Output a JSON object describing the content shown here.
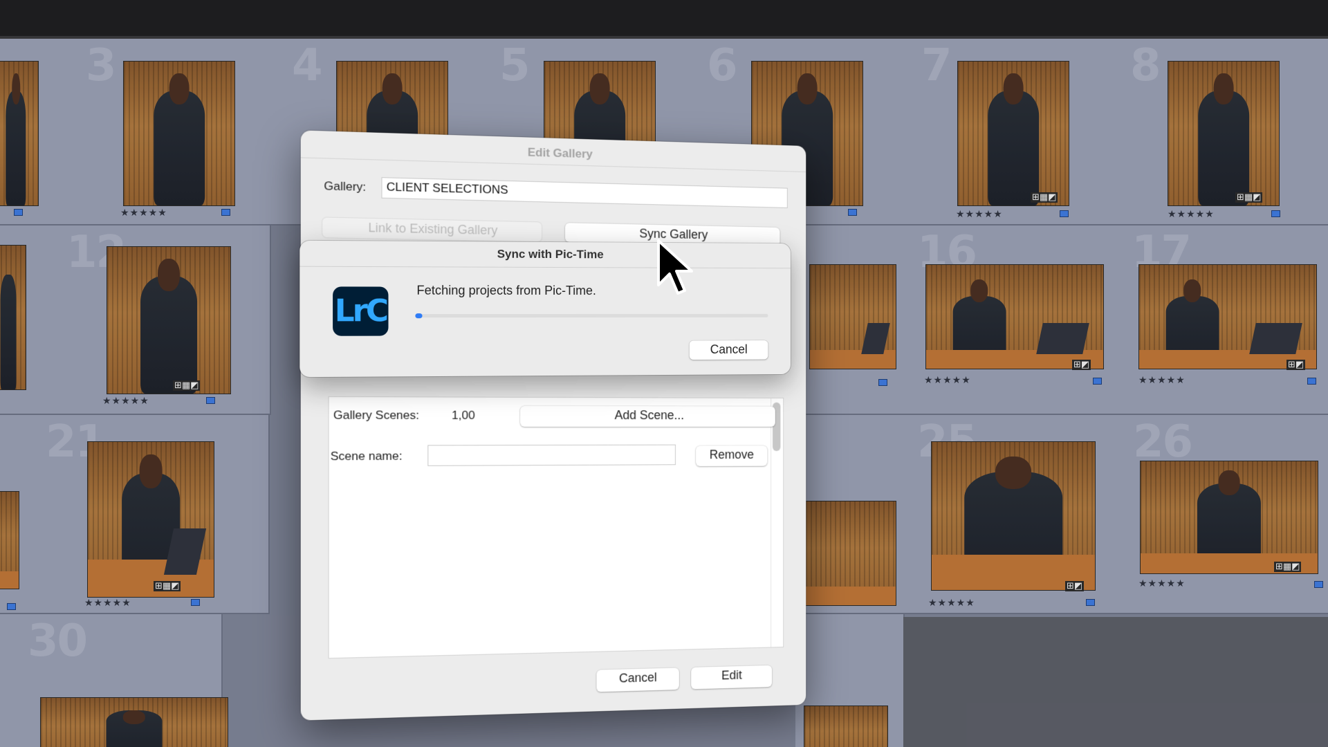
{
  "grid": {
    "cells": [
      {
        "num": "3",
        "stars": "★★★★★"
      },
      {
        "num": "4",
        "stars": ""
      },
      {
        "num": "5",
        "stars": ""
      },
      {
        "num": "6",
        "stars": ""
      },
      {
        "num": "7",
        "stars": "★★★★★"
      },
      {
        "num": "8",
        "stars": "★★★★★"
      },
      {
        "num": "12",
        "stars": "★★★★★"
      },
      {
        "num": "16",
        "stars": "★★★★★"
      },
      {
        "num": "17",
        "stars": "★★★★★"
      },
      {
        "num": "21",
        "stars": "★★★★★"
      },
      {
        "num": "25",
        "stars": "★★★★★"
      },
      {
        "num": "26",
        "stars": "★★★★★"
      },
      {
        "num": "30",
        "stars": ""
      }
    ]
  },
  "edit_gallery": {
    "title": "Edit Gallery",
    "gallery_label": "Gallery:",
    "gallery_value": "CLIENT SELECTIONS",
    "link_button": "Link to Existing Gallery",
    "sync_button": "Sync Gallery",
    "scenes_label": "Gallery Scenes:",
    "scenes_value": "1,00",
    "add_scene_button": "Add Scene...",
    "scene_name_label": "Scene name:",
    "scene_name_value": "",
    "remove_button": "Remove",
    "cancel_button": "Cancel",
    "edit_button": "Edit"
  },
  "sync_sheet": {
    "title": "Sync with Pic-Time",
    "app_icon_text": "LrC",
    "message": "Fetching projects from Pic-Time.",
    "progress": 0.02,
    "cancel_button": "Cancel"
  },
  "colors": {
    "accent": "#2f7cf6",
    "lrc_bg": "#001e36",
    "lrc_fg": "#31a8ff",
    "flag": "#3f7be0"
  },
  "icons": [
    "mouse-cursor-icon",
    "lrc-app-icon"
  ]
}
